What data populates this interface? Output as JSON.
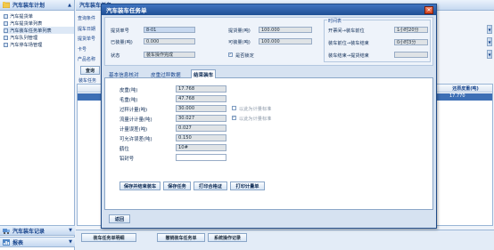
{
  "left_nav": {
    "header": "汽车装车计划",
    "items": [
      {
        "label": "汽车提货单"
      },
      {
        "label": "汽车提货单列表"
      },
      {
        "label": "汽车装车任务单列表",
        "selected": true
      },
      {
        "label": "汽车队列管理"
      },
      {
        "label": "汽车停车场管理"
      }
    ],
    "bottom": [
      {
        "label": "汽车装车记录"
      },
      {
        "label": "报表"
      }
    ]
  },
  "main": {
    "header": "汽车装车任务",
    "query_labels": [
      "查询条件",
      "提车日期",
      "提货单号",
      "卡号",
      "产品名称"
    ],
    "query_button": "查询",
    "grid_title": "装车任务",
    "grid_col_header": "还原皮重(吨)",
    "grid_col_value": "17.770",
    "bottom_buttons": {
      "detail": "装车任务单明细",
      "cancel": "撤销装车任务单",
      "log": "系统操作记录"
    }
  },
  "dialog": {
    "title": "汽车装车任务单",
    "close": "✕",
    "top": {
      "pickup_no_label": "提货单号",
      "pickup_no_value": "8-01",
      "pickup_qty_label": "提货量(吨)",
      "pickup_qty_value": "100.000",
      "loaded_qty_label": "已装量(吨)",
      "loaded_qty_value": "0.000",
      "loadable_qty_label": "可装量(吨)",
      "loadable_qty_value": "100.000",
      "status_label": "状态",
      "status_value": "装车操作完成",
      "locked_label": "是否锁定",
      "time_title": "时间表",
      "time_rows": [
        {
          "label": "开票间→装车前位",
          "value": "1小时20分"
        },
        {
          "label": "装车前位→装车结束",
          "value": "0小时3分"
        },
        {
          "label": "装车结束→提货结束",
          "value": ""
        }
      ]
    },
    "tabs": [
      {
        "label": "基本信息核对"
      },
      {
        "label": "皮重过秤数据"
      },
      {
        "label": "结束装车",
        "active": true
      }
    ],
    "fields": [
      {
        "label": "皮重(吨)",
        "value": "17.768"
      },
      {
        "label": "毛重(吨)",
        "value": "47.768"
      },
      {
        "label": "过秤计量(吨)",
        "value": "30.000",
        "checkbox_label": "以此为计量标准",
        "checked": false
      },
      {
        "label": "流量计计量(吨)",
        "value": "30.027",
        "checkbox_label": "以此为计量标准",
        "checked": true
      },
      {
        "label": "计量误差(吨)",
        "value": "0.027"
      },
      {
        "label": "可允许误差(吨)",
        "value": "0.150"
      },
      {
        "label": "鹤位",
        "value": "10#"
      },
      {
        "label": "铅封号",
        "value": ""
      }
    ],
    "actions": {
      "save_finish": "保存并结束装车",
      "save": "保存任务",
      "print_cert": "打印合格证",
      "print_measure": "打印计量单"
    },
    "back": "返回"
  }
}
